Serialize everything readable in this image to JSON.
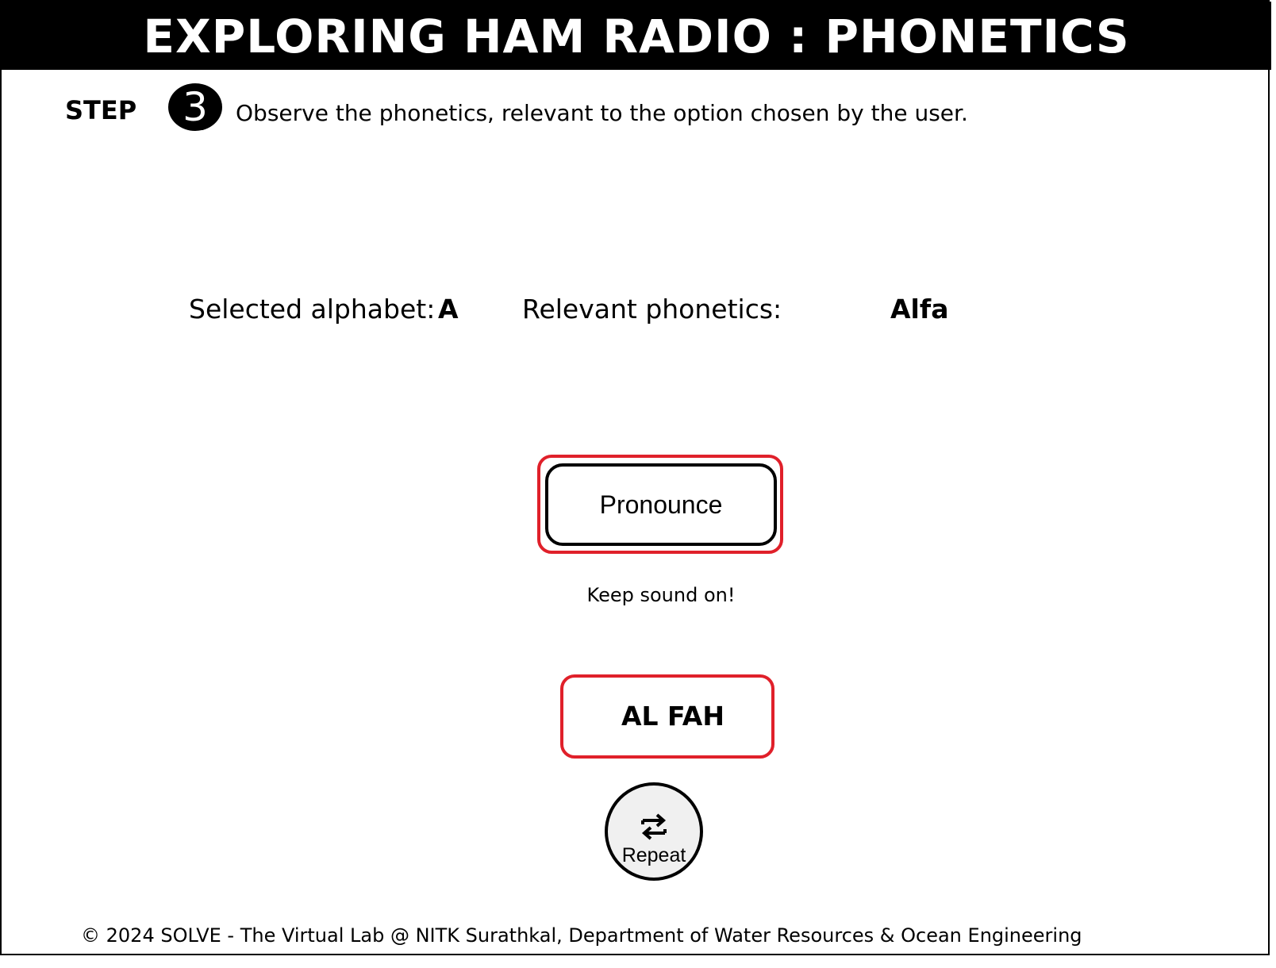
{
  "header": {
    "title": "EXPLORING HAM RADIO : PHONETICS"
  },
  "step": {
    "label": "STEP",
    "number": "3",
    "instruction": "Observe the phonetics, relevant to the option chosen by the user."
  },
  "selection": {
    "alphabet_label": "Selected alphabet:",
    "alphabet_value": "A",
    "phonetics_label": "Relevant phonetics:",
    "phonetics_value": "Alfa"
  },
  "pronounce": {
    "button_label": "Pronounce",
    "hint": "Keep sound on!"
  },
  "pronunciation": {
    "text": "AL FAH"
  },
  "repeat": {
    "label": "Repeat",
    "icon": "repeat-icon"
  },
  "footer": {
    "text": "© 2024 SOLVE - The Virtual Lab @ NITK Surathkal, Department of Water Resources & Ocean Engineering"
  },
  "colors": {
    "accent_outline": "#e0202a",
    "header_bg": "#000000",
    "repeat_bg": "#f0f0f0"
  }
}
